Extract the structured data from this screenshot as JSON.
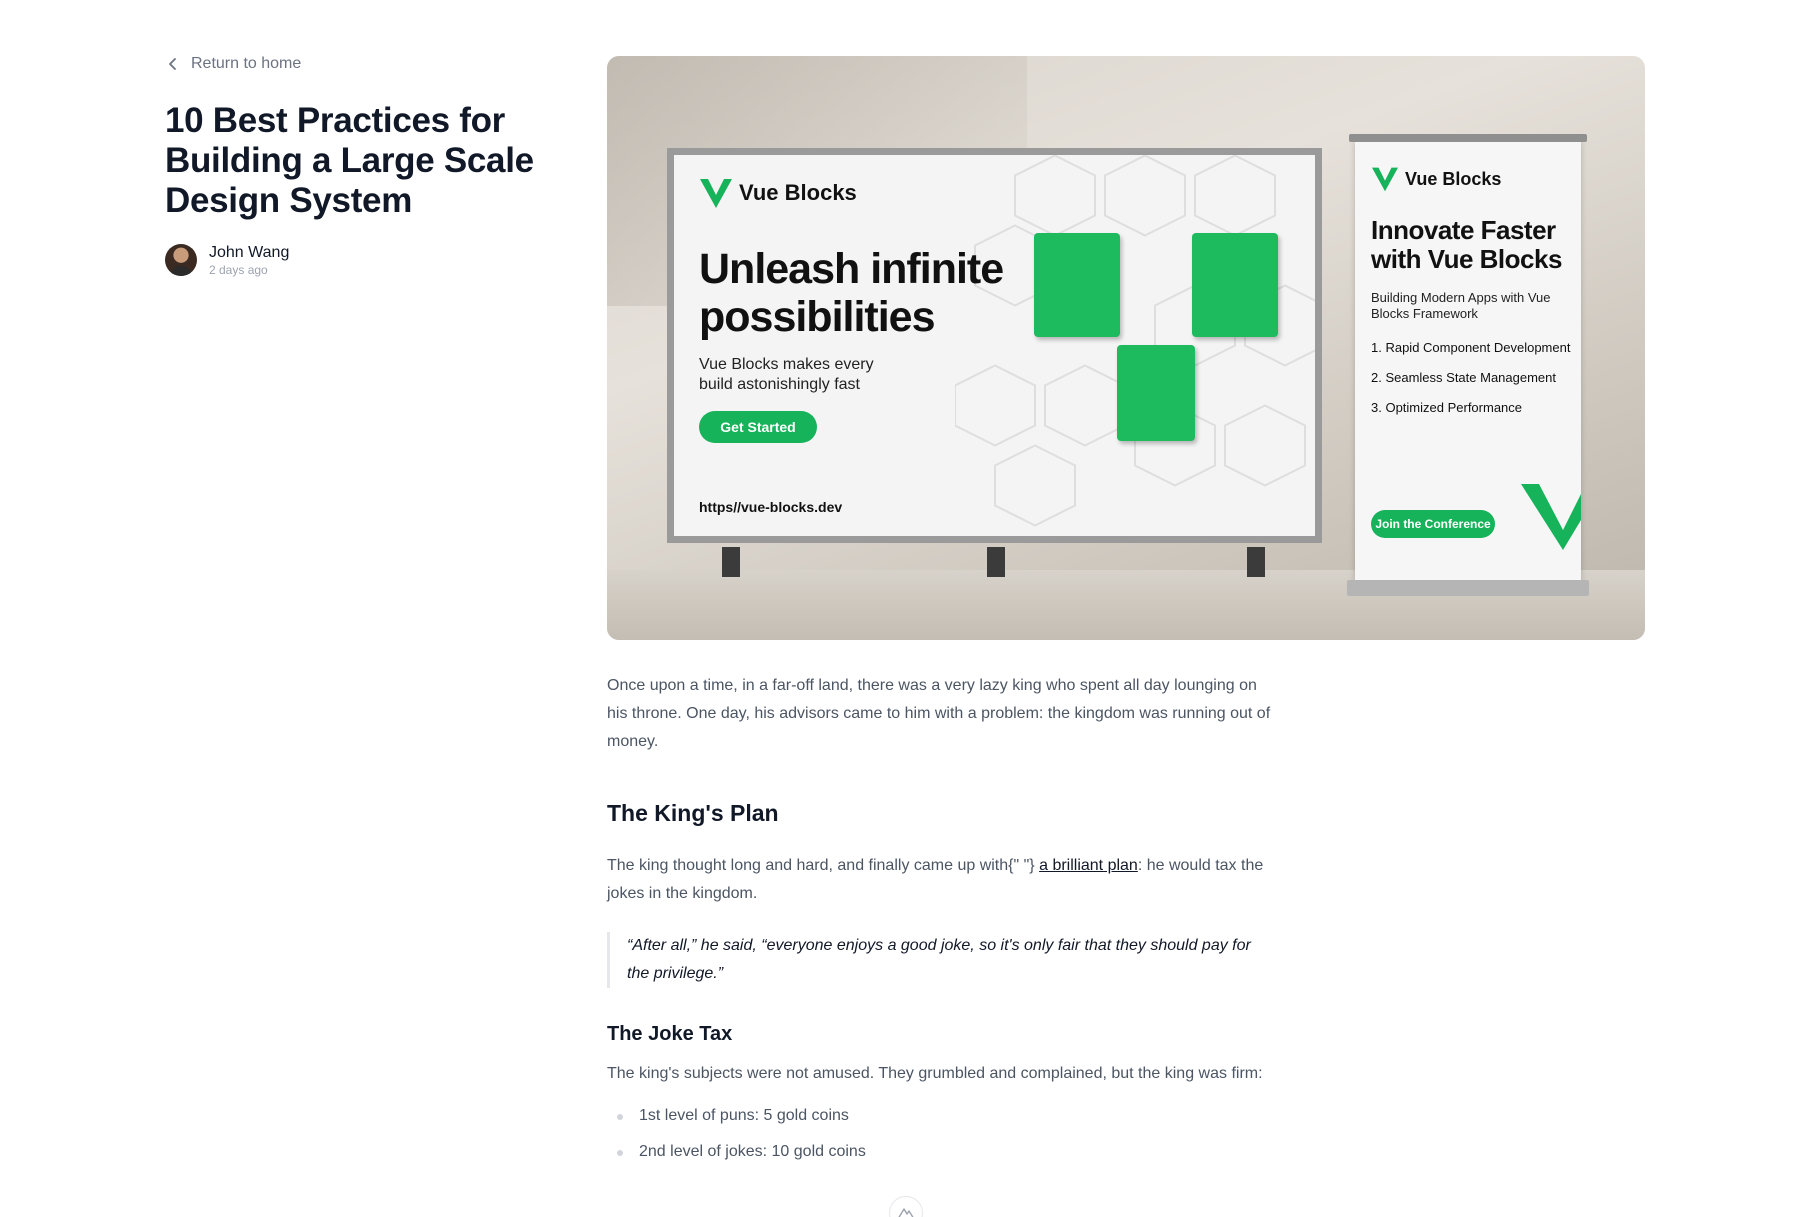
{
  "nav": {
    "back_label": "Return to home"
  },
  "post": {
    "title": "10 Best Practices for Building a Large Scale Design System",
    "author": {
      "name": "John Wang",
      "time": "2 days ago"
    }
  },
  "hero": {
    "billboard": {
      "brand": "Vue Blocks",
      "headline": "Unleash infinite possibilities",
      "subtitle": "Vue Blocks makes every build astonishingly fast",
      "cta": "Get Started",
      "url": "https//vue-blocks.dev"
    },
    "banner": {
      "brand": "Vue Blocks",
      "headline": "Innovate Faster with Vue Blocks",
      "subtitle": "Building Modern Apps with Vue Blocks Framework",
      "items": [
        "1. Rapid Component Development",
        "2. Seamless State Management",
        "3. Optimized Performance"
      ],
      "cta": "Join the Conference"
    },
    "accent_color": "#16b35a"
  },
  "article": {
    "intro": "Once upon a time, in a far-off land, there was a very lazy king who spent all day lounging on his throne. One day, his advisors came to him with a problem: the kingdom was running out of money.",
    "section1_title": "The King's Plan",
    "plan_text_before": "The king thought long and hard, and finally came up with{\" \"} ",
    "plan_link": "a brilliant plan",
    "plan_text_after": ": he would tax the jokes in the kingdom.",
    "quote": "“After all,” he said, “everyone enjoys a good joke, so it's only fair that they should pay for the privilege.”",
    "section2_title": "The Joke Tax",
    "tax_text": "The king's subjects were not amused. They grumbled and complained, but the king was firm:",
    "tax_list": [
      "1st level of puns: 5 gold coins",
      "2nd level of jokes: 10 gold coins"
    ]
  },
  "icons": {
    "back": "chevron-left-icon",
    "badge": "nuxt-mountain-icon"
  }
}
